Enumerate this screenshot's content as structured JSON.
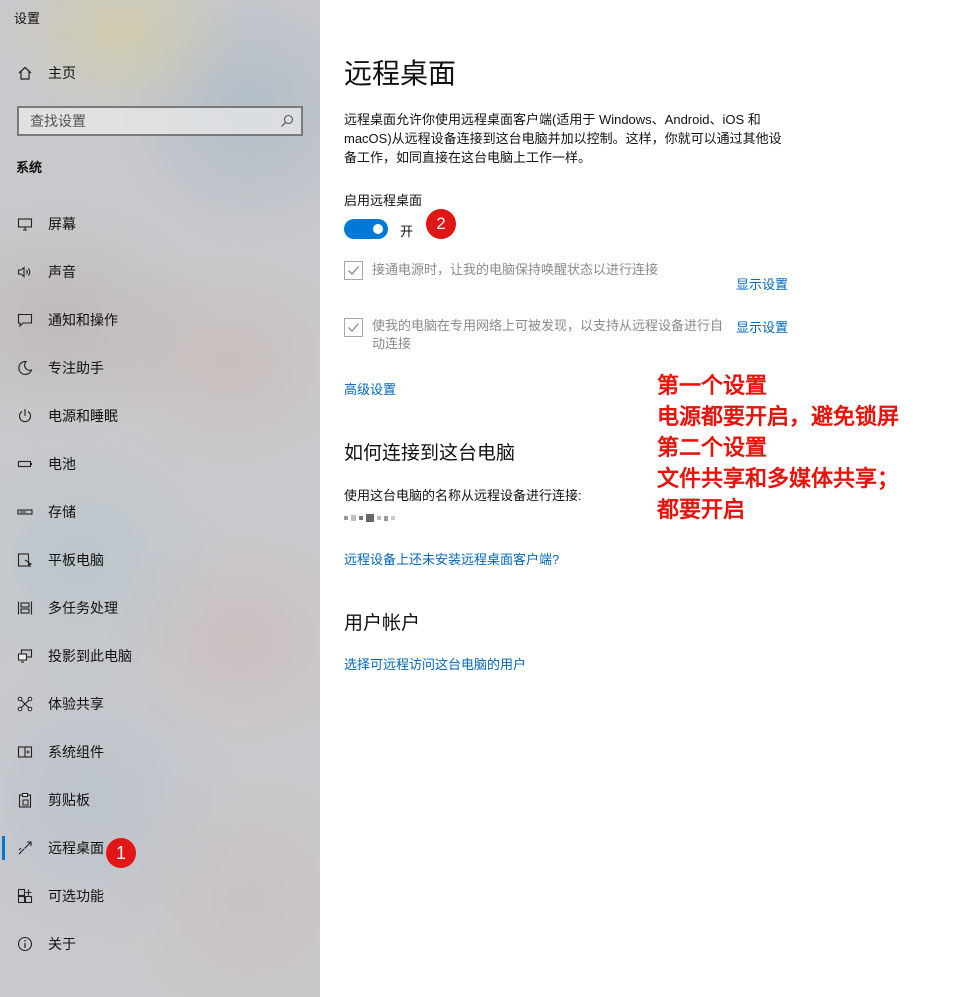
{
  "window": {
    "title": "设置"
  },
  "sidebar": {
    "home_label": "主页",
    "search_placeholder": "查找设置",
    "section_title": "系统",
    "items": [
      {
        "label": "屏幕",
        "icon": "display-icon"
      },
      {
        "label": "声音",
        "icon": "speaker-icon"
      },
      {
        "label": "通知和操作",
        "icon": "message-icon"
      },
      {
        "label": "专注助手",
        "icon": "moon-icon"
      },
      {
        "label": "电源和睡眠",
        "icon": "power-icon"
      },
      {
        "label": "电池",
        "icon": "battery-icon"
      },
      {
        "label": "存储",
        "icon": "storage-icon"
      },
      {
        "label": "平板电脑",
        "icon": "tablet-icon"
      },
      {
        "label": "多任务处理",
        "icon": "multitask-icon"
      },
      {
        "label": "投影到此电脑",
        "icon": "project-icon"
      },
      {
        "label": "体验共享",
        "icon": "share-icon"
      },
      {
        "label": "系统组件",
        "icon": "components-icon"
      },
      {
        "label": "剪贴板",
        "icon": "clipboard-icon"
      },
      {
        "label": "远程桌面",
        "icon": "remote-desktop-icon",
        "selected": true
      },
      {
        "label": "可选功能",
        "icon": "optional-features-icon"
      },
      {
        "label": "关于",
        "icon": "info-icon"
      }
    ],
    "badge": "1"
  },
  "main": {
    "title": "远程桌面",
    "description": "远程桌面允许你使用远程桌面客户端(适用于 Windows、Android、iOS 和 macOS)从远程设备连接到这台电脑并加以控制。这样，你就可以通过其他设备工作，如同直接在这台电脑上工作一样。",
    "toggle_label": "启用远程桌面",
    "toggle_state": "开",
    "toggle_on": true,
    "badge": "2",
    "options": [
      {
        "text": "接通电源时，让我的电脑保持唤醒状态以进行连接",
        "link": "显示设置",
        "checked": true
      },
      {
        "text": "使我的电脑在专用网络上可被发现，以支持从远程设备进行自动连接",
        "link": "显示设置",
        "checked": true
      }
    ],
    "advanced_link": "高级设置",
    "connect_heading": "如何连接到这台电脑",
    "connect_text": "使用这台电脑的名称从远程设备进行连接:",
    "client_link": "远程设备上还未安装远程桌面客户端?",
    "accounts_heading": "用户帐户",
    "accounts_link": "选择可远程访问这台电脑的用户"
  },
  "annotation": {
    "lines": [
      "第一个设置",
      "电源都要开启，避免锁屏",
      "第二个设置",
      "文件共享和多媒体共享；",
      "都要开启"
    ],
    "color": "#e8140c"
  },
  "colors": {
    "accent": "#0078d7",
    "link": "#0067b8",
    "badge": "#e11616"
  }
}
